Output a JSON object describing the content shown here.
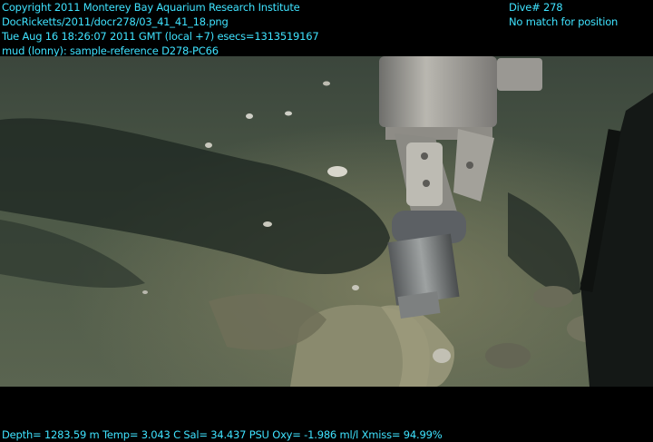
{
  "overlay": {
    "top_left": [
      "Copyright 2011 Monterey Bay Aquarium Research Institute",
      "DocRicketts/2011/docr278/03_41_41_18.png",
      "Tue Aug 16 18:26:07 2011 GMT (local +7)  esecs=1313519167",
      "mud (lonny): sample-reference D278-PC66"
    ],
    "top_right": [
      "Dive# 278",
      "No match for position"
    ],
    "bottom": "Depth= 1283.59 m  Temp= 3.043 C  Sal= 34.437 PSU  Oxy= -1.986 ml/l  Xmiss= 94.99%"
  },
  "colors": {
    "overlay_text": "#3fe3ff",
    "seafloor": "#4e5a48",
    "shadow": "#1c2620",
    "sediment_highlight": "#8a8a6e"
  },
  "image": {
    "subject": "ROV manipulator pushing a push-core tube into muddy seafloor sediment"
  }
}
